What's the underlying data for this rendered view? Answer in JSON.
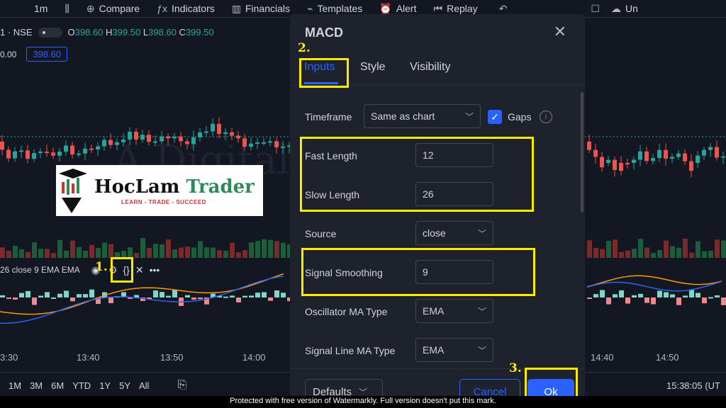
{
  "toolbar": {
    "interval": "1m",
    "compare": "Compare",
    "indicators": "Indicators",
    "financials": "Financials",
    "templates": "Templates",
    "alert": "Alert",
    "replay": "Replay",
    "undo_label": "Un"
  },
  "symbol": {
    "name": "1 · NSE",
    "o_label": "O",
    "o": "398.60",
    "h_label": "H",
    "h": "399.50",
    "l_label": "L",
    "l": "398.60",
    "c_label": "C",
    "c": "399.50",
    "left_value": "0.00",
    "price_box": "398.60"
  },
  "logo": {
    "title_a": "HocLam",
    "title_b": "Trader",
    "tagline": "LEARN - TRADE - SUCCEED"
  },
  "indicator_legend": {
    "text": "26 close 9 EMA EMA"
  },
  "annotations": {
    "step1": "1.",
    "step2": "2.",
    "step3": "3."
  },
  "x_axis": {
    "labels_left": [
      "3:30",
      "13:40",
      "13:50",
      "14:00"
    ],
    "labels_right": [
      "14:40",
      "14:50"
    ]
  },
  "bottom_bar": {
    "ranges": [
      "1M",
      "3M",
      "6M",
      "YTD",
      "1Y",
      "5Y",
      "All"
    ],
    "clock": "15:38:05 (UT"
  },
  "watermark_text": "Protected with free version of Watermarkly. Full version doesn't put this mark.",
  "background_watermark": "A Digital Blogger",
  "dialog": {
    "title": "MACD",
    "tabs": [
      {
        "label": "Inputs",
        "active": true
      },
      {
        "label": "Style",
        "active": false
      },
      {
        "label": "Visibility",
        "active": false
      }
    ],
    "fields": {
      "timeframe": {
        "label": "Timeframe",
        "value": "Same as chart"
      },
      "gaps": {
        "label": "Gaps",
        "checked": true
      },
      "fast_length": {
        "label": "Fast Length",
        "value": "12"
      },
      "slow_length": {
        "label": "Slow Length",
        "value": "26"
      },
      "source": {
        "label": "Source",
        "value": "close"
      },
      "signal_smoothing": {
        "label": "Signal Smoothing",
        "value": "9"
      },
      "osc_ma_type": {
        "label": "Oscillator MA Type",
        "value": "EMA"
      },
      "signal_ma_type": {
        "label": "Signal Line MA Type",
        "value": "EMA"
      }
    },
    "footer": {
      "defaults": "Defaults",
      "cancel": "Cancel",
      "ok": "Ok"
    }
  },
  "colors": {
    "background": "#131722",
    "dialog": "#1e222d",
    "accent": "#2962ff",
    "up": "#26a69a",
    "down": "#ef5350",
    "highlight": "#ffeb00"
  }
}
